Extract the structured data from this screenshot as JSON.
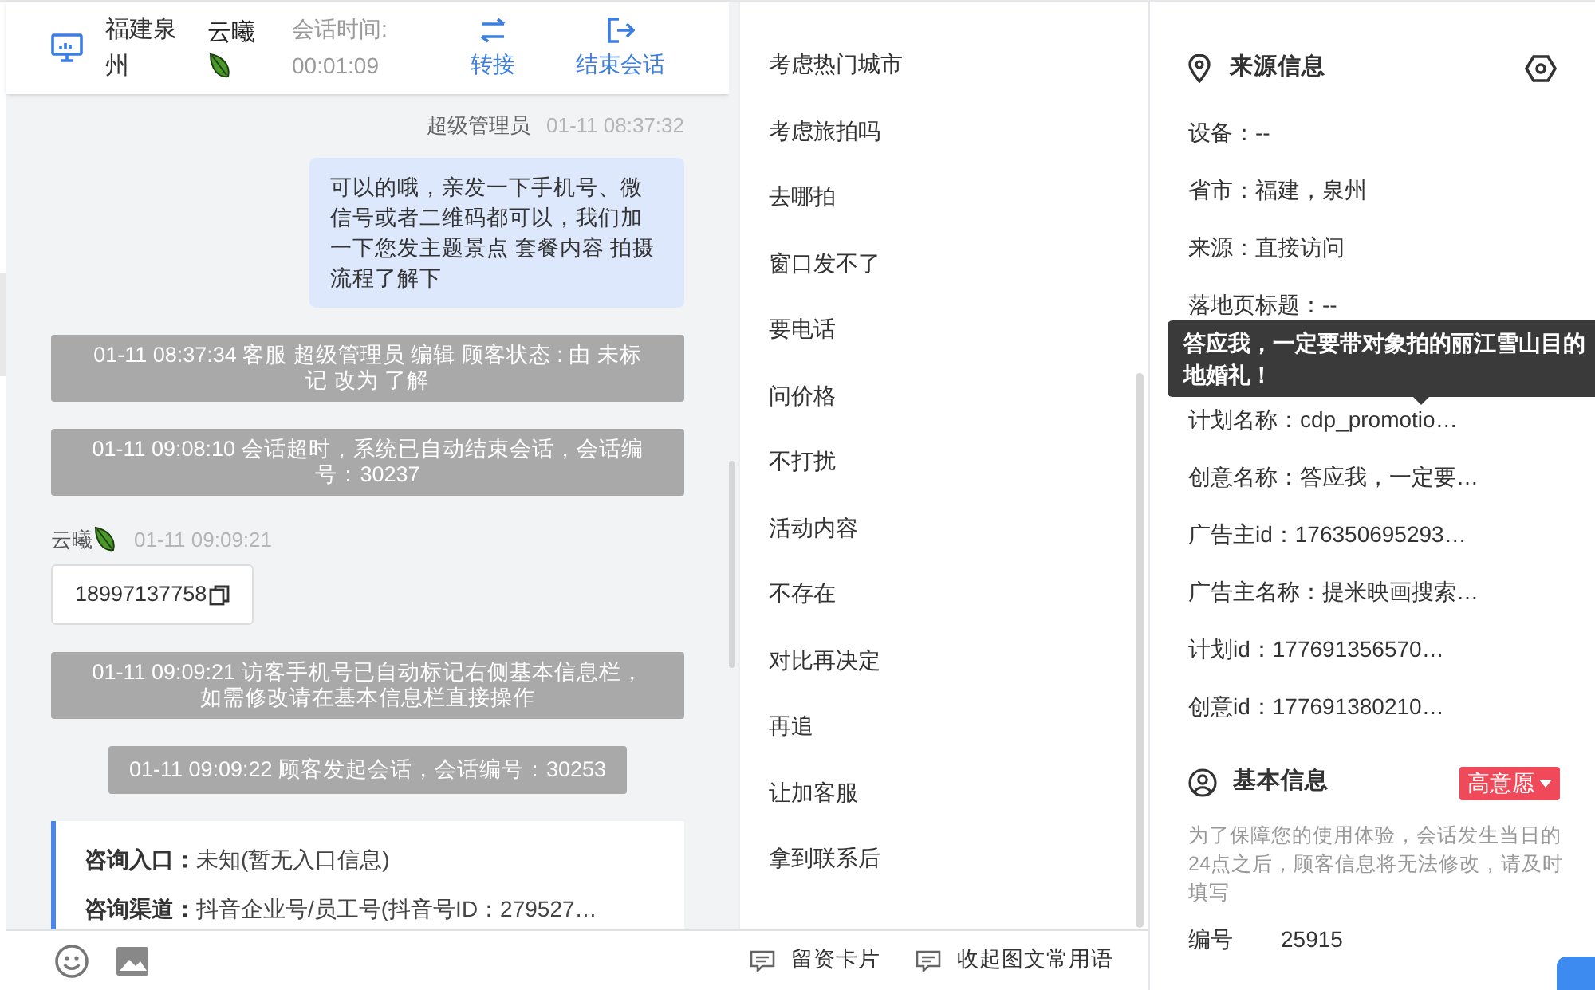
{
  "header": {
    "location": "福建泉州",
    "visitor": "云曦",
    "duration_label": "会话时间:",
    "duration": "00:01:09",
    "actions": [
      {
        "kind": "transfer",
        "label": "转接"
      },
      {
        "kind": "end",
        "label": "结束会话"
      }
    ]
  },
  "messages": [
    {
      "kind": "meta_right",
      "sender": "超级管理员",
      "time": "01-11 08:37:32"
    },
    {
      "kind": "bubble_out",
      "text": "可以的哦，亲发一下手机号、微信号或者二维码都可以，我们加一下您发主题景点 套餐内容 拍摄流程了解下"
    },
    {
      "kind": "system",
      "text": "01-11 08:37:34 客服 超级管理员 编辑 顾客状态 : 由 未标记 改为 了解"
    },
    {
      "kind": "system",
      "text": "01-11 09:08:10 会话超时，系统已自动结束会话，会话编号：30237"
    },
    {
      "kind": "meta_left",
      "sender": "云曦",
      "time": "01-11 09:09:21"
    },
    {
      "kind": "phone",
      "text": "18997137758"
    },
    {
      "kind": "system",
      "text": "01-11 09:09:21 访客手机号已自动标记右侧基本信息栏，如需修改请在基本信息栏直接操作"
    },
    {
      "kind": "system_short",
      "text": "01-11 09:09:22 顾客发起会话，会话编号：30253"
    },
    {
      "kind": "info",
      "rows": [
        {
          "label": "咨询入口：",
          "value": "未知(暂无入口信息)"
        },
        {
          "label": "咨询渠道：",
          "value": "抖音企业号/员工号(抖音号ID：279527…"
        }
      ]
    }
  ],
  "quick_replies": [
    "考虑热门城市",
    "考虑旅拍吗",
    "去哪拍",
    "窗口发不了",
    "要电话",
    "问价格",
    "不打扰",
    "活动内容",
    "不存在",
    "对比再决定",
    "再追",
    "让加客服",
    "拿到联系后"
  ],
  "footer": {
    "tools": [
      {
        "kind": "emoji"
      },
      {
        "kind": "image"
      }
    ],
    "buttons": [
      "留资卡片",
      "收起图文常用语"
    ]
  },
  "source": {
    "title": "来源信息",
    "rows": [
      "设备：--",
      "省市：福建，泉州",
      "来源：直接访问",
      "落地页标题：--",
      "计划名称：cdp_promotio…",
      "创意名称：答应我，一定要…",
      "广告主id：176350695293…",
      "广告主名称：提米映画搜索…",
      "计划id：177691356570…",
      "创意id：177691380210…"
    ],
    "tooltip": "答应我，一定要带对象拍的丽江雪山目的地婚礼！"
  },
  "basic": {
    "title": "基本信息",
    "intent": "高意愿",
    "notice": "为了保障您的使用体验，会话发生当日的24点之后，顾客信息将无法修改，请及时填写",
    "field_label": "编号",
    "field_value": "25915"
  }
}
